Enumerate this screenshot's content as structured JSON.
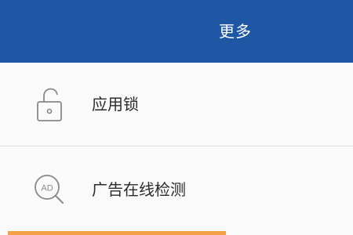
{
  "header": {
    "title": "更多",
    "background_color": "#1f57a4"
  },
  "items": [
    {
      "label": "应用锁",
      "icon": "lock-icon"
    },
    {
      "label": "广告在线检测",
      "icon": "ad-search-icon",
      "icon_text": "AD"
    }
  ],
  "accent_strip": {
    "color": "#f3a24a"
  }
}
